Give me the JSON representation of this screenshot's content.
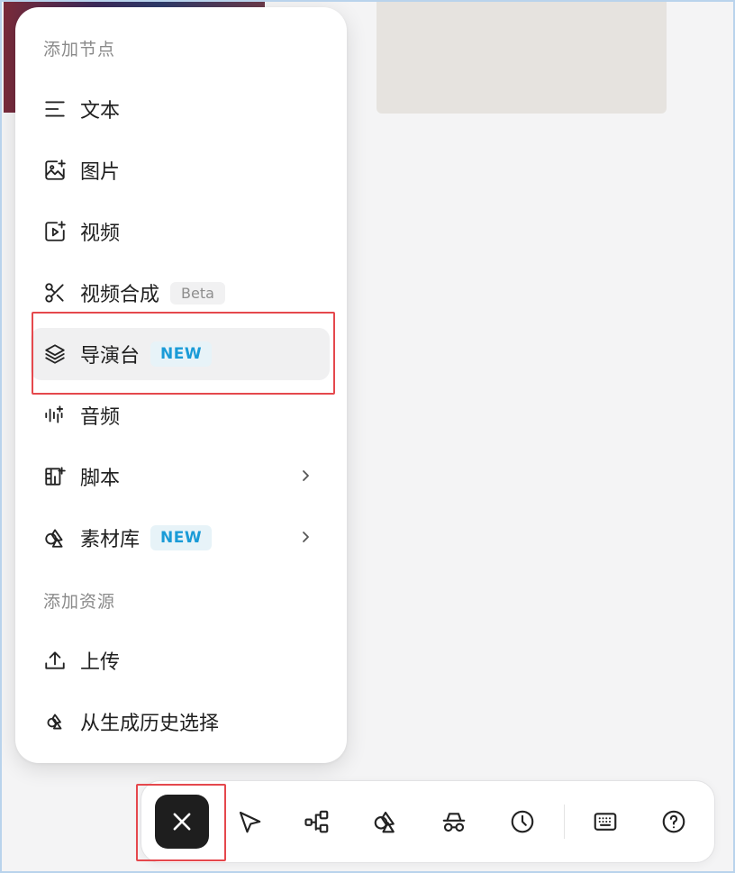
{
  "menu": {
    "sections": [
      {
        "title": "添加节点"
      },
      {
        "title": "添加资源"
      }
    ],
    "items": [
      {
        "label": "文本",
        "icon": "text-lines-icon"
      },
      {
        "label": "图片",
        "icon": "image-sparkle-icon"
      },
      {
        "label": "视频",
        "icon": "video-sparkle-icon"
      },
      {
        "label": "视频合成",
        "icon": "scissors-icon",
        "badge": "Beta"
      },
      {
        "label": "导演台",
        "icon": "layers-icon",
        "badge": "NEW",
        "active": true
      },
      {
        "label": "音频",
        "icon": "audio-wave-icon"
      },
      {
        "label": "脚本",
        "icon": "storyboard-icon",
        "has_submenu": true
      },
      {
        "label": "素材库",
        "icon": "shapes-icon",
        "badge": "NEW",
        "has_submenu": true
      }
    ],
    "resource_items": [
      {
        "label": "上传",
        "icon": "upload-icon"
      },
      {
        "label": "从生成历史选择",
        "icon": "history-shapes-icon"
      }
    ]
  },
  "toolbar": {
    "buttons": [
      {
        "name": "close",
        "icon": "close-icon"
      },
      {
        "name": "select",
        "icon": "cursor-arrow-icon"
      },
      {
        "name": "workflow",
        "icon": "node-graph-icon"
      },
      {
        "name": "assets",
        "icon": "shapes-icon"
      },
      {
        "name": "incognito",
        "icon": "incognito-icon"
      },
      {
        "name": "history",
        "icon": "clock-icon"
      },
      {
        "name": "shortcuts",
        "icon": "keyboard-icon"
      },
      {
        "name": "help",
        "icon": "help-icon"
      }
    ]
  },
  "colors": {
    "highlight": "#e5484d",
    "new_badge_text": "#1a9bd7",
    "new_badge_bg": "#e7f3f8",
    "close_button_bg": "#1e1e1e"
  }
}
